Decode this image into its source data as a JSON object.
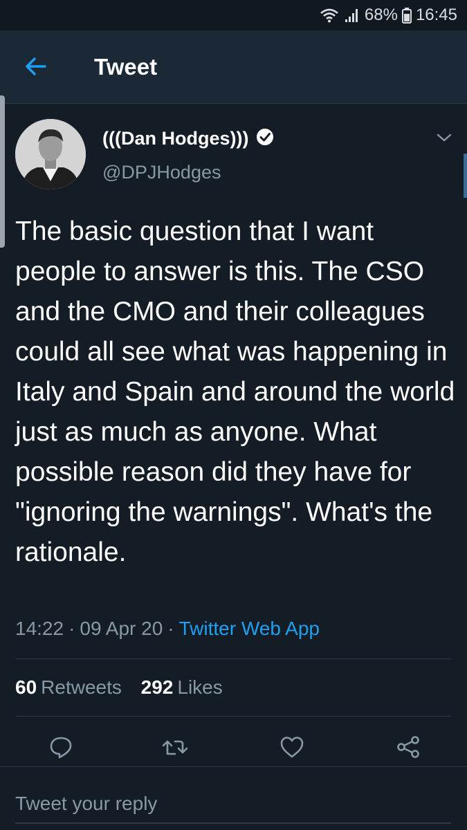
{
  "status_bar": {
    "battery": "68%",
    "time": "16:45",
    "icons": [
      "wifi-icon",
      "signal-icon",
      "battery-icon"
    ]
  },
  "header": {
    "title": "Tweet",
    "back_icon": "arrow-left-icon"
  },
  "tweet": {
    "display_name": "(((Dan Hodges)))",
    "verified": true,
    "handle": "@DPJHodges",
    "text": "The basic question that I want people to answer is this. The CSO and the CMO and their colleagues could all see what was happening in Italy and Spain and around the world just as much as anyone. What possible reason did they have for \"ignoring the warnings\". What's the rationale.",
    "time": "14:22",
    "date": "09 Apr 20",
    "separator": "·",
    "source": "Twitter Web App",
    "retweets_count": "60",
    "retweets_label": "Retweets",
    "likes_count": "292",
    "likes_label": "Likes"
  },
  "actions": [
    "reply-icon",
    "retweet-icon",
    "like-icon",
    "share-icon"
  ],
  "reply": {
    "placeholder": "Tweet your reply"
  },
  "colors": {
    "background": "#141d26",
    "header": "#1b2836",
    "accent": "#1da1f2",
    "muted": "#8899a6",
    "divider": "#2c3a48"
  }
}
